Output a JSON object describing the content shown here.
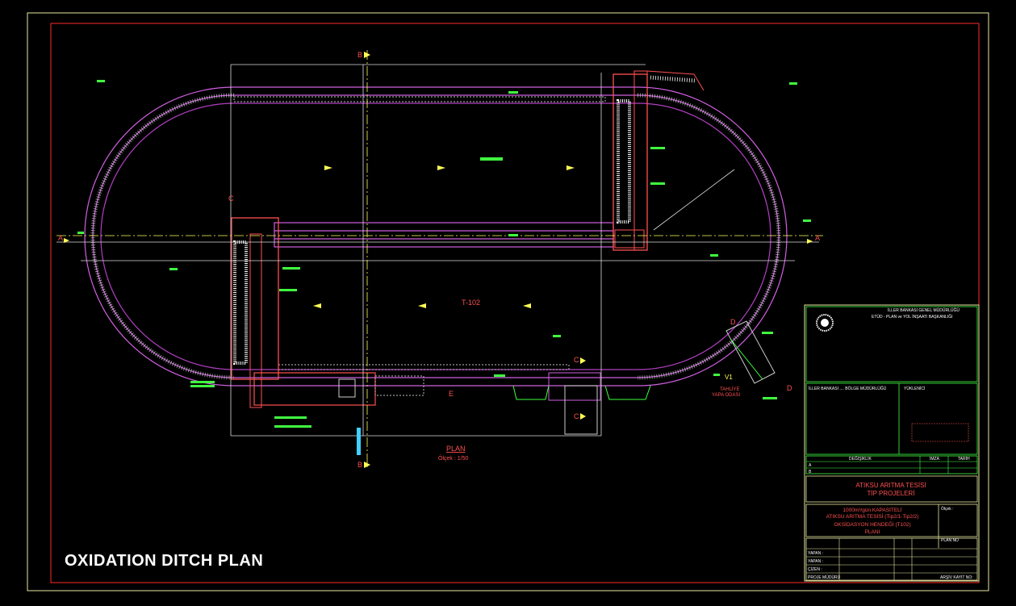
{
  "drawing": {
    "caption": "OXIDATION DITCH PLAN",
    "tank_label": "T-102",
    "plan_title": "PLAN",
    "plan_scale": "Ölçek : 1/50",
    "section_marks": {
      "a": "A",
      "b": "B",
      "c": "C",
      "d": "D",
      "e": "E"
    },
    "outlet_label_1": "V1",
    "outlet_label_2": "TAHLİYE",
    "outlet_label_3": "YAPA ODASI"
  },
  "title_block": {
    "org_line_1": "İLLER BANKASI GENEL MÜDÜRLÜĞÜ",
    "org_line_2": "ETÜD - PLAN ve YOL İNŞAATI BAŞKANLIĞI",
    "region": "İLLER BANKASI .... BÖLGE MÜDÜRLÜĞÜ",
    "approval": "YÜKLENİCİ",
    "revision_header": "DEĞİŞİKLİK",
    "signature_header": "İMZA",
    "date_header": "TARİH",
    "revision_a": "A",
    "revision_b": "B",
    "project_line_1": "ATIKSU ARITMA TESİSİ",
    "project_line_2": "TİP PROJELERİ",
    "sheet_line_1": "1000m³/gün KAPASİTELİ",
    "sheet_line_2": "ATIKSU ARITMA TESİSİ (Tip2/1-Tip2/2)",
    "sheet_line_3": "OKSİDASYON HENDEĞİ (T102)",
    "sheet_line_4": "PLANI",
    "scale_label": "Ölçek :",
    "role_1": "YAPAN :",
    "role_2": "YAPAN :",
    "role_3": "ÇİZEN :",
    "role_4": "PROJE MÜDÜRÜ",
    "archive": "ARŞİV KAYIT NO:",
    "plan_no_label": "PLAN NO"
  }
}
